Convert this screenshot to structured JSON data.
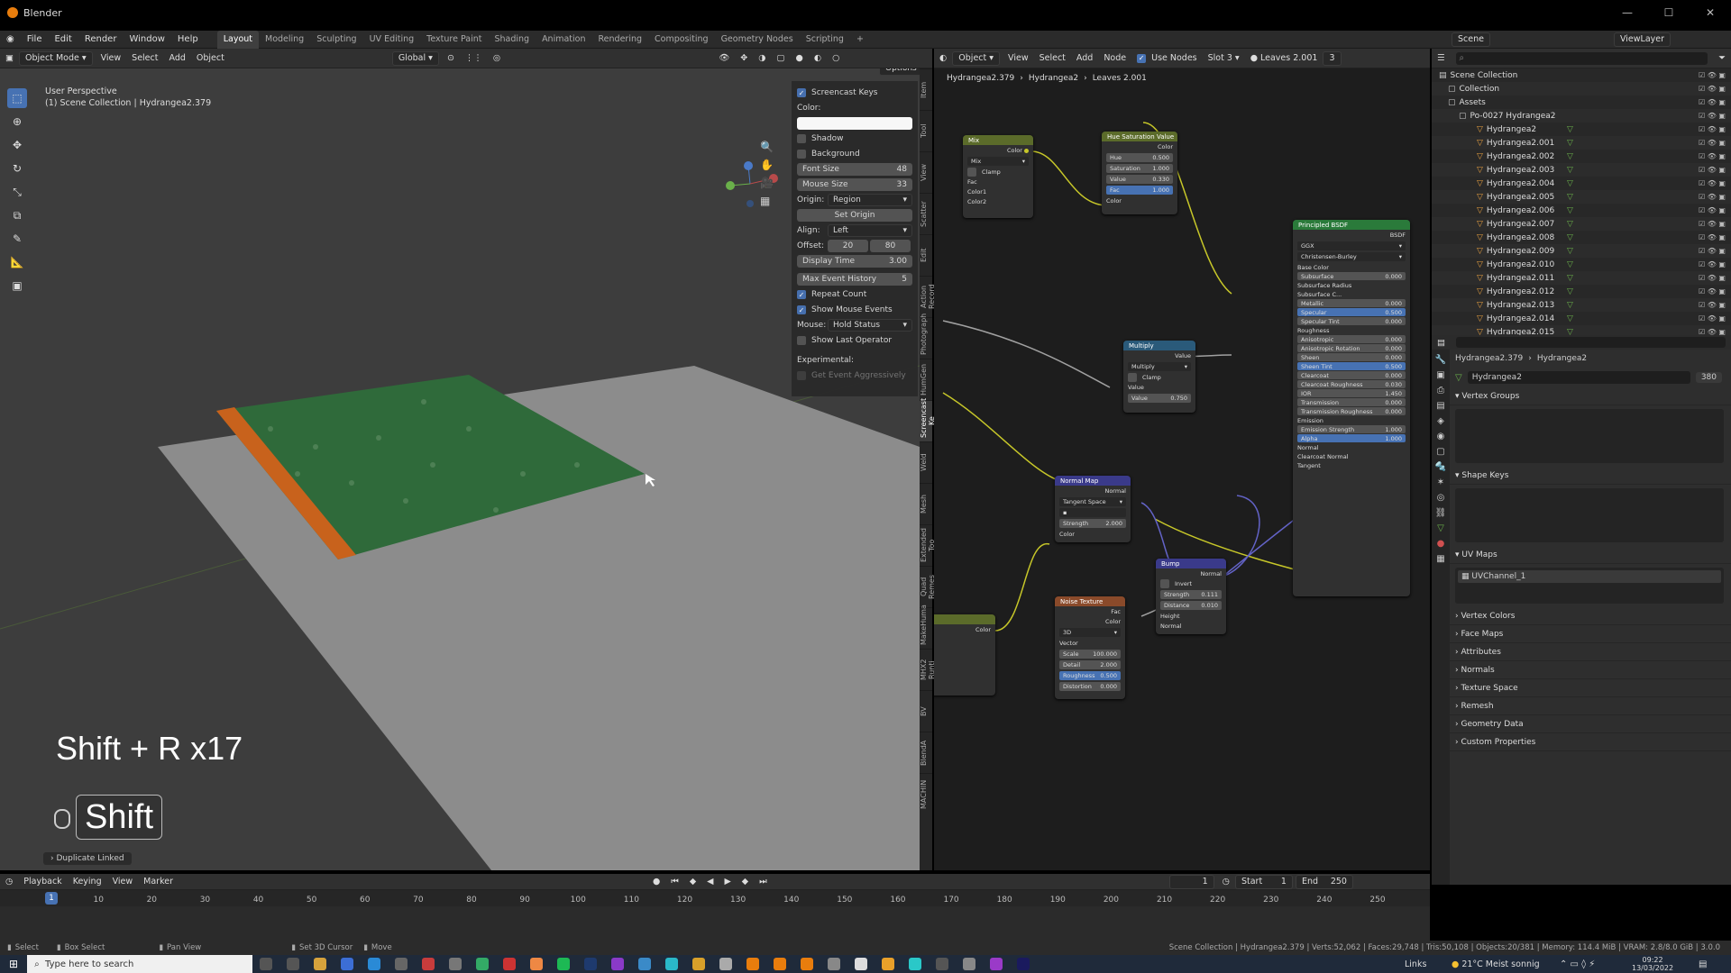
{
  "window": {
    "title": "Blender",
    "controls": [
      "—",
      "☐",
      "✕"
    ]
  },
  "menu": [
    "File",
    "Edit",
    "Render",
    "Window",
    "Help"
  ],
  "workspaces": [
    "Layout",
    "Modeling",
    "Sculpting",
    "UV Editing",
    "Texture Paint",
    "Shading",
    "Animation",
    "Rendering",
    "Compositing",
    "Geometry Nodes",
    "Scripting"
  ],
  "active_workspace": "Layout",
  "scene": {
    "name": "Scene",
    "view_layer": "ViewLayer"
  },
  "viewport": {
    "mode": "Object Mode",
    "menus": [
      "View",
      "Select",
      "Add",
      "Object"
    ],
    "orientation": "Global",
    "perspective": "User Perspective",
    "collection_path": "(1) Scene Collection | Hydrangea2.379",
    "options_label": "Options"
  },
  "screencast_panel": {
    "title": "Screencast Keys",
    "color_label": "Color:",
    "shadow": "Shadow",
    "background": "Background",
    "font_size_label": "Font Size",
    "font_size": "48",
    "mouse_size_label": "Mouse Size",
    "mouse_size": "33",
    "origin_label": "Origin:",
    "origin": "Region",
    "set_origin": "Set Origin",
    "align_label": "Align:",
    "align": "Left",
    "offset_label": "Offset:",
    "offset_x": "20",
    "offset_y": "80",
    "display_time_label": "Display Time",
    "display_time": "3.00",
    "max_history_label": "Max Event History",
    "max_history": "5",
    "repeat_count": "Repeat Count",
    "show_mouse": "Show Mouse Events",
    "mouse_label": "Mouse:",
    "mouse_mode": "Hold Status",
    "show_last_op": "Show Last Operator",
    "experimental": "Experimental:",
    "get_event": "Get Event Aggressively"
  },
  "side_tabs": [
    "Item",
    "Tool",
    "View",
    "Scatter",
    "Edit",
    "Action Record",
    "Photograph",
    "HumGen",
    "Screencast Ke",
    "Weld",
    "Mesh",
    "Extended Too",
    "Quad Remes",
    "MakeHuma",
    "MHX2 Runti",
    "BV",
    "BlendA",
    "MACHIN"
  ],
  "overlay": {
    "keys": "Shift + R x17",
    "held_key": "Shift",
    "last_operator": "Duplicate Linked"
  },
  "node_editor": {
    "mode": "Object",
    "menus": [
      "View",
      "Select",
      "Add",
      "Node"
    ],
    "use_nodes": "Use Nodes",
    "slot": "Slot 3",
    "material": "Leaves 2.001",
    "users": "3",
    "breadcrumb": [
      "Hydrangea2.379",
      "Hydrangea2",
      "Leaves 2.001"
    ],
    "nodes": {
      "mix": {
        "title": "Mix",
        "out": "Color",
        "mode": "Mix",
        "clamp": "Clamp",
        "fac": "Fac",
        "c1": "Color1",
        "c2": "Color2"
      },
      "hsv": {
        "title": "Hue Saturation Value",
        "out": "Color",
        "hue_l": "Hue",
        "hue": "0.500",
        "sat_l": "Saturation",
        "sat": "1.000",
        "val_l": "Value",
        "val": "0.330",
        "fac_l": "Fac",
        "fac": "1.000",
        "in": "Color"
      },
      "bsdf": {
        "title": "Principled BSDF",
        "out": "BSDF",
        "dist": "GGX",
        "ss": "Christensen-Burley",
        "rows": [
          [
            "Base Color",
            ""
          ],
          [
            "Subsurface",
            "0.000"
          ],
          [
            "Subsurface Radius",
            ""
          ],
          [
            "Subsurface C...",
            ""
          ],
          [
            "Metallic",
            "0.000"
          ],
          [
            "Specular",
            "0.500"
          ],
          [
            "Specular Tint",
            "0.000"
          ],
          [
            "Roughness",
            ""
          ],
          [
            "Anisotropic",
            "0.000"
          ],
          [
            "Anisotropic Rotation",
            "0.000"
          ],
          [
            "Sheen",
            "0.000"
          ],
          [
            "Sheen Tint",
            "0.500"
          ],
          [
            "Clearcoat",
            "0.000"
          ],
          [
            "Clearcoat Roughness",
            "0.030"
          ],
          [
            "IOR",
            "1.450"
          ],
          [
            "Transmission",
            "0.000"
          ],
          [
            "Transmission Roughness",
            "0.000"
          ],
          [
            "Emission",
            ""
          ],
          [
            "Emission Strength",
            "1.000"
          ],
          [
            "Alpha",
            "1.000"
          ],
          [
            "Normal",
            ""
          ],
          [
            "Clearcoat Normal",
            ""
          ],
          [
            "Tangent",
            ""
          ]
        ]
      },
      "multiply": {
        "title": "Multiply",
        "out": "Value",
        "op": "Multiply",
        "clamp": "Clamp",
        "in": "Value",
        "val_l": "Value",
        "val": "0.750"
      },
      "normal_map": {
        "title": "Normal Map",
        "out": "Normal",
        "space": "Tangent Space",
        "str_l": "Strength",
        "str": "2.000",
        "in": "Color"
      },
      "bump": {
        "title": "Bump",
        "out": "Normal",
        "invert": "Invert",
        "str_l": "Strength",
        "str": "0.111",
        "dist_l": "Distance",
        "dist": "0.010",
        "height": "Height",
        "normal": "Normal"
      },
      "noise": {
        "title": "Noise Texture",
        "fac": "Fac",
        "color": "Color",
        "dim": "3D",
        "vector": "Vector",
        "scale_l": "Scale",
        "scale": "100.000",
        "detail_l": "Detail",
        "detail": "2.000",
        "rough_l": "Roughness",
        "rough": "0.500",
        "dist_l": "Distortion",
        "dist": "0.000"
      },
      "partial": {
        "out": "Color"
      }
    }
  },
  "outliner": {
    "root": "Scene Collection",
    "collection": "Collection",
    "assets": "Assets",
    "group": "Po-0027 Hydrangea2",
    "items": [
      "Hydrangea2",
      "Hydrangea2.001",
      "Hydrangea2.002",
      "Hydrangea2.003",
      "Hydrangea2.004",
      "Hydrangea2.005",
      "Hydrangea2.006",
      "Hydrangea2.007",
      "Hydrangea2.008",
      "Hydrangea2.009",
      "Hydrangea2.010",
      "Hydrangea2.011",
      "Hydrangea2.012",
      "Hydrangea2.013",
      "Hydrangea2.014",
      "Hydrangea2.015"
    ]
  },
  "properties": {
    "object": "Hydrangea2.379",
    "mesh": "Hydrangea2",
    "data_name": "Hydrangea2",
    "users": "380",
    "sections": [
      "Vertex Groups",
      "Shape Keys",
      "UV Maps"
    ],
    "uv_map": "UVChannel_1",
    "collapsed": [
      "Vertex Colors",
      "Face Maps",
      "Attributes",
      "Normals",
      "Texture Space",
      "Remesh",
      "Geometry Data",
      "Custom Properties"
    ]
  },
  "timeline": {
    "menus": [
      "Playback",
      "Keying",
      "View",
      "Marker"
    ],
    "current": "1",
    "start_label": "Start",
    "start": "1",
    "end_label": "End",
    "end": "250",
    "ruler": [
      "10",
      "20",
      "30",
      "40",
      "50",
      "60",
      "70",
      "80",
      "90",
      "100",
      "110",
      "120",
      "130",
      "140",
      "150",
      "160",
      "170",
      "180",
      "190",
      "200",
      "210",
      "220",
      "230",
      "240",
      "250"
    ]
  },
  "status": {
    "select": "Select",
    "box_select": "Box Select",
    "pan_view": "Pan View",
    "set_cursor": "Set 3D Cursor",
    "move": "Move",
    "stats": "Scene Collection | Hydrangea2.379 | Verts:52,062 | Faces:29,748 | Tris:50,108 | Objects:20/381 | Memory: 114.4 MiB | VRAM: 2.8/8.0 GiB | 3.0.0"
  },
  "taskbar": {
    "search": "Type here to search",
    "links": "Links",
    "weather": "21°C  Meist sonnig",
    "time": "09:22",
    "date": "13/03/2022"
  }
}
